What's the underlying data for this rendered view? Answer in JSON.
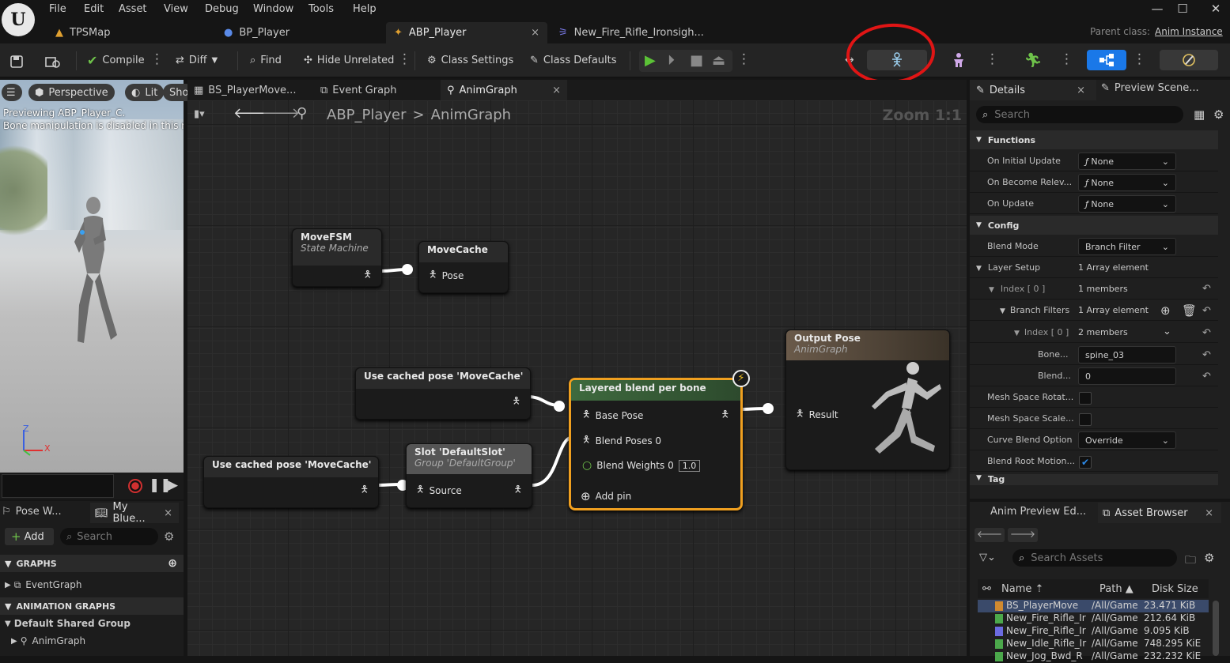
{
  "menu": [
    "File",
    "Edit",
    "Asset",
    "View",
    "Debug",
    "Window",
    "Tools",
    "Help"
  ],
  "doc_tabs": [
    {
      "label": "TPSMap",
      "active": false
    },
    {
      "label": "BP_Player",
      "active": false
    },
    {
      "label": "ABP_Player",
      "active": true
    },
    {
      "label": "New_Fire_Rifle_Ironsigh...",
      "active": false
    }
  ],
  "parent_class": {
    "label": "Parent class:",
    "value": "Anim Instance"
  },
  "toolbar": {
    "compile": "Compile",
    "diff": "Diff",
    "find": "Find",
    "hide_unrelated": "Hide Unrelated",
    "class_settings": "Class Settings",
    "class_defaults": "Class Defaults"
  },
  "viewport": {
    "perspective": "Perspective",
    "lit": "Lit",
    "show": "Sho",
    "preview_line1": "Previewing ABP_Player_C.",
    "preview_line2": "Bone manipulation is disabled in this mo",
    "axis_z": "Z",
    "axis_x": "X"
  },
  "left_panel": {
    "tab_pose": "Pose W...",
    "tab_blueprint": "My Blue...",
    "add": "Add",
    "search_placeholder": "Search",
    "graphs_header": "GRAPHS",
    "event_graph": "EventGraph",
    "anim_graphs_header": "ANIMATION GRAPHS",
    "default_group": "Default Shared Group",
    "anim_graph": "AnimGraph"
  },
  "graph_tabs": [
    {
      "label": "BS_PlayerMove...",
      "active": false
    },
    {
      "label": "Event Graph",
      "active": false
    },
    {
      "label": "AnimGraph",
      "active": true
    }
  ],
  "breadcrumb": {
    "root": "ABP_Player",
    "sep": ">",
    "current": "AnimGraph"
  },
  "zoom": "Zoom 1:1",
  "nodes": {
    "movefsm": {
      "title": "MoveFSM",
      "subtitle": "State Machine"
    },
    "movecache": {
      "title": "MoveCache",
      "pin": "Pose"
    },
    "cached1": {
      "title": "Use cached pose 'MoveCache'"
    },
    "cached2": {
      "title": "Use cached pose 'MoveCache'"
    },
    "slot": {
      "title": "Slot 'DefaultSlot'",
      "subtitle": "Group 'DefaultGroup'",
      "pin": "Source"
    },
    "layered": {
      "title": "Layered blend per bone",
      "base": "Base Pose",
      "blend_poses": "Blend Poses 0",
      "blend_weights": "Blend Weights 0",
      "weight_value": "1.0",
      "add_pin": "Add pin"
    },
    "output": {
      "title": "Output Pose",
      "subtitle": "AnimGraph",
      "pin": "Result"
    }
  },
  "details": {
    "tab_details": "Details",
    "tab_preview": "Preview Scene...",
    "search_placeholder": "Search",
    "functions_header": "Functions",
    "on_initial_update": "On Initial Update",
    "on_become_relevant": "On Become Relev...",
    "on_update": "On Update",
    "none": "None",
    "config_header": "Config",
    "blend_mode": "Blend Mode",
    "blend_mode_value": "Branch Filter",
    "layer_setup": "Layer Setup",
    "layer_setup_value": "1 Array element",
    "index0": "Index [ 0 ]",
    "index0_value": "1 members",
    "branch_filters": "Branch Filters",
    "branch_filters_value": "1 Array element",
    "index0b": "Index [ 0 ]",
    "index0b_value": "2 members",
    "bone": "Bone...",
    "bone_value": "spine_03",
    "blend": "Blend...",
    "blend_value": "0",
    "mesh_rot": "Mesh Space Rotat...",
    "mesh_scale": "Mesh Space Scale...",
    "curve_blend": "Curve Blend Option",
    "curve_blend_value": "Override",
    "blend_root": "Blend Root Motion...",
    "tag": "Tag"
  },
  "assets": {
    "tab_anim_preview": "Anim Preview Ed...",
    "tab_asset_browser": "Asset Browser",
    "search_placeholder": "Search Assets",
    "columns": [
      "Name",
      "Path",
      "Disk Size"
    ],
    "rows": [
      {
        "name": "BS_PlayerMove",
        "path": "/All/Game",
        "size": "23.471 KiB",
        "color": "#d08a30",
        "selected": true
      },
      {
        "name": "New_Fire_Rifle_Ir",
        "path": "/All/Game",
        "size": "212.64 KiB",
        "color": "#4ba84b",
        "selected": false
      },
      {
        "name": "New_Fire_Rifle_Ir",
        "path": "/All/Game",
        "size": "9.095 KiB",
        "color": "#6b6be0",
        "selected": false
      },
      {
        "name": "New_Idle_Rifle_Ir",
        "path": "/All/Game",
        "size": "748.295 KiE",
        "color": "#4ba84b",
        "selected": false
      },
      {
        "name": "New_Jog_Bwd_R",
        "path": "/All/Game",
        "size": "232.232 KiE",
        "color": "#4ba84b",
        "selected": false
      }
    ]
  }
}
